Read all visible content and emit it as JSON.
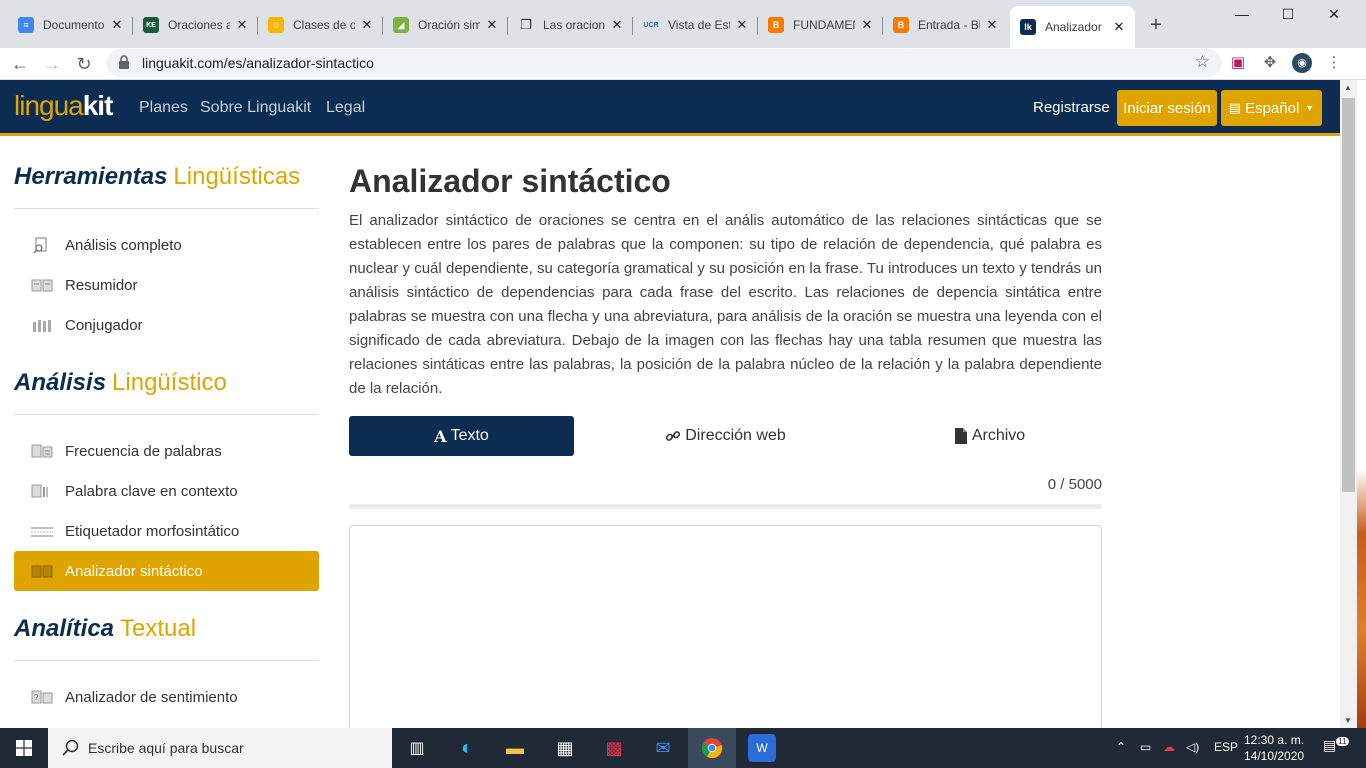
{
  "browser": {
    "tabs": [
      {
        "label": "Documento",
        "fav_color": "#4285f4",
        "fav_glyph": "≡"
      },
      {
        "label": "Oraciones a",
        "fav_color": "#1a5c3a",
        "fav_glyph": "KE"
      },
      {
        "label": "Clases de o",
        "fav_color": "#f7b500",
        "fav_glyph": "☺"
      },
      {
        "label": "Oración sim",
        "fav_color": "#7cb342",
        "fav_glyph": "◢"
      },
      {
        "label": "Las oracion",
        "fav_color": "#ffffff",
        "fav_glyph": "📖"
      },
      {
        "label": "Vista de Est",
        "fav_color": "#ffffff",
        "fav_glyph": "UCR"
      },
      {
        "label": "FUNDAMEN",
        "fav_color": "#f57c00",
        "fav_glyph": "B"
      },
      {
        "label": "Entrada - Bl",
        "fav_color": "#f57c00",
        "fav_glyph": "B"
      },
      {
        "label": "Analizador",
        "fav_color": "#0c2c51",
        "fav_glyph": "lk",
        "active": true
      }
    ],
    "url": "linguakit.com/es/analizador-sintactico"
  },
  "header": {
    "logo_light": "lingua",
    "logo_bold": "kit",
    "nav": [
      "Planes",
      "Sobre Linguakit",
      "Legal"
    ],
    "register": "Registrarse",
    "login": "Iniciar sesión",
    "language": "Español"
  },
  "sidebar": {
    "sections": [
      {
        "title": "Herramientas",
        "accent": "Lingüísticas",
        "items": [
          "Análisis completo",
          "Resumidor",
          "Conjugador"
        ]
      },
      {
        "title": "Análisis",
        "accent": "Lingüístico",
        "items": [
          "Frecuencia de palabras",
          "Palabra clave en contexto",
          "Etiquetador morfosintático",
          "Analizador sintáctico"
        ]
      },
      {
        "title": "Analítica",
        "accent": "Textual",
        "items": [
          "Analizador de sentimiento"
        ]
      }
    ],
    "active_item": "Analizador sintáctico"
  },
  "main": {
    "title": "Analizador sintáctico",
    "description": "El analizador sintáctico de oraciones se centra en el anális automático de las relaciones sintácticas que se establecen entre los pares de palabras que la componen: su tipo de relación de dependencia, qué palabra es nuclear y cuál dependiente, su categoría gramatical y su posición en la frase. Tu introduces un texto y tendrás un análisis sintáctico de dependencias para cada frase del escrito. Las relaciones de depencia sintática entre palabras se muestra con una flecha y una abreviatura, para análisis de la oración se muestra una leyenda con el significado de cada abreviatura. Debajo de la imagen con las flechas hay una tabla resumen que muestra las relaciones sintáticas entre las palabras, la posición de la palabra núcleo de la relación y la palabra dependiente de la relación.",
    "tabs": [
      {
        "label": "Texto",
        "active": true
      },
      {
        "label": "Dirección web",
        "active": false
      },
      {
        "label": "Archivo",
        "active": false
      }
    ],
    "counter": "0 / 5000",
    "text_value": "",
    "progress_fraction": 0
  },
  "taskbar": {
    "search_placeholder": "Escribe aquí para buscar",
    "language": "ESP",
    "time": "12:30 a. m.",
    "date": "14/10/2020",
    "notifications": "11"
  },
  "colors": {
    "navy": "#0c2c51",
    "accent": "#e0a400"
  }
}
